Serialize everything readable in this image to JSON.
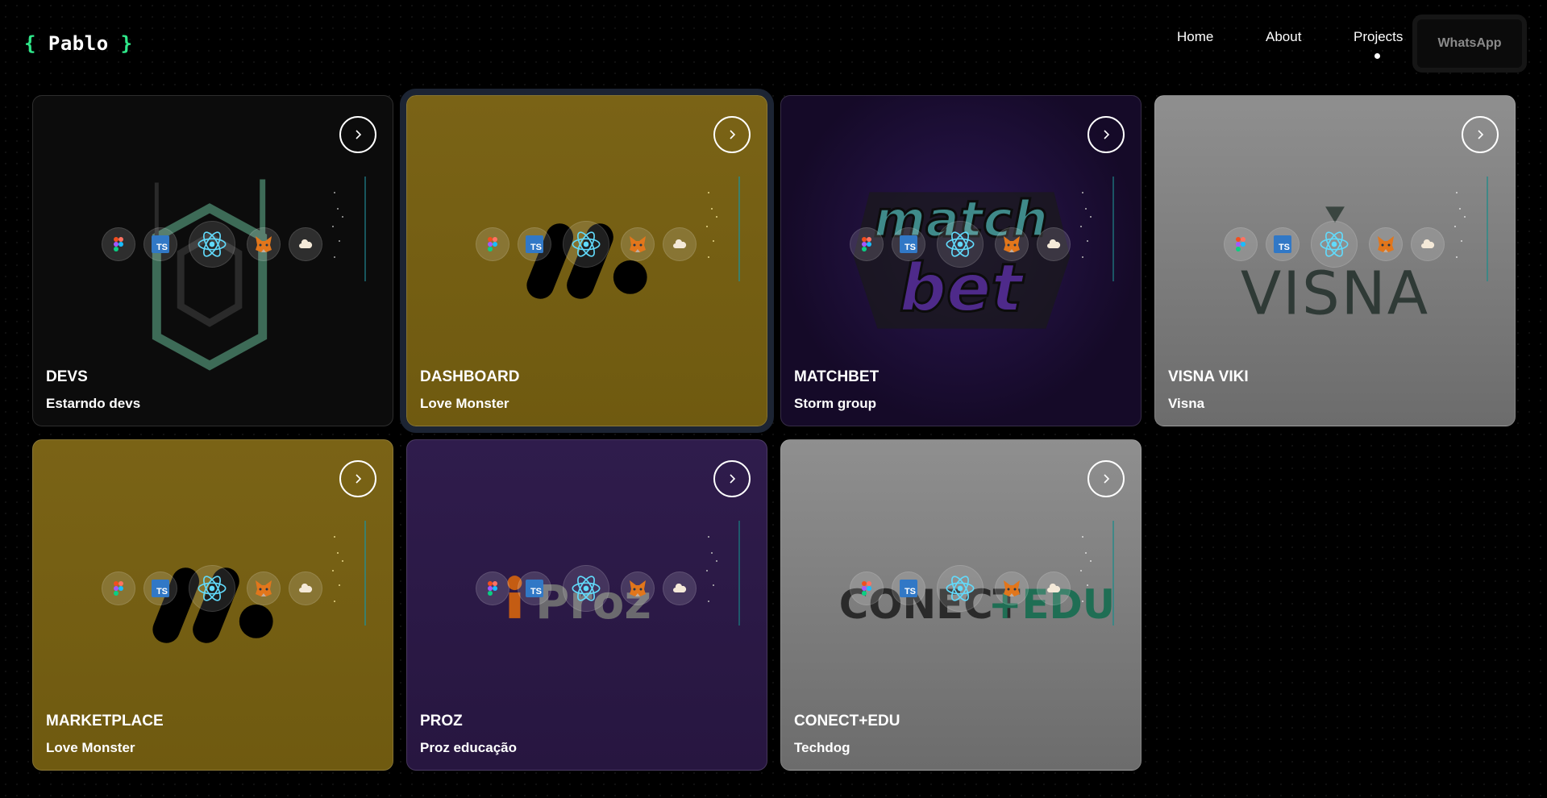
{
  "header": {
    "logo": {
      "open": "{",
      "name": "Pablo",
      "close": "}"
    },
    "nav": [
      {
        "label": "Home"
      },
      {
        "label": "About"
      },
      {
        "label": "Projects",
        "active": true
      }
    ],
    "cta_label": "WhatsApp"
  },
  "tech_icons": [
    "figma-icon",
    "typescript-icon",
    "react-icon",
    "metamask-icon",
    "cloud-icon"
  ],
  "projects": [
    {
      "title": "DEVS",
      "subtitle": "Estarndo devs",
      "bg": "#0c0c0c",
      "logo": "hexagon-d"
    },
    {
      "title": "DASHBOARD",
      "subtitle": "Love Monster",
      "bg": "#7a6113",
      "logo": "slashes",
      "active": true
    },
    {
      "title": "MATCHBET",
      "subtitle": "Storm group",
      "bg": "#1b0d32",
      "logo": "match-bet"
    },
    {
      "title": "VISNA VIKI",
      "subtitle": "Visna",
      "bg": "#8c8c8c",
      "logo": "visna"
    },
    {
      "title": "MARKETPLACE",
      "subtitle": "Love Monster",
      "bg": "#7a6113",
      "logo": "slashes"
    },
    {
      "title": "PROZ",
      "subtitle": "Proz educação",
      "bg": "#2c1a47",
      "logo": "proz"
    },
    {
      "title": "CONECT+EDU",
      "subtitle": "Techdog",
      "bg": "#8c8c8c",
      "logo": "conect-edu"
    }
  ],
  "logo_text": {
    "match": "match",
    "bet": "bet",
    "visna": "VISNA",
    "proz": "Proz",
    "conect": "CONECT",
    "edu": "+EDU"
  }
}
